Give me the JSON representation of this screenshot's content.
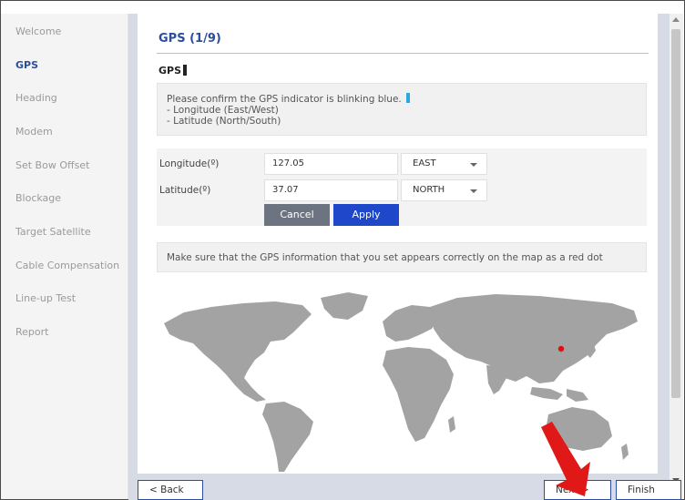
{
  "sidebar": {
    "items": [
      {
        "label": "Welcome",
        "active": false
      },
      {
        "label": "GPS",
        "active": true
      },
      {
        "label": "Heading",
        "active": false
      },
      {
        "label": "Modem",
        "active": false
      },
      {
        "label": "Set Bow Offset",
        "active": false
      },
      {
        "label": "Blockage",
        "active": false
      },
      {
        "label": "Target Satellite",
        "active": false
      },
      {
        "label": "Cable Compensation",
        "active": false
      },
      {
        "label": "Line-up Test",
        "active": false
      },
      {
        "label": "Report",
        "active": false
      }
    ]
  },
  "page": {
    "title": "GPS (1/9)",
    "section_label": "GPS"
  },
  "info": {
    "line1": "Please confirm the GPS indicator is blinking blue.",
    "line2": "- Longitude (East/West)",
    "line3": "- Latitude (North/South)"
  },
  "form": {
    "longitude_label": "Longitude(º)",
    "longitude_value": "127.05",
    "longitude_dir": "EAST",
    "latitude_label": "Latitude(º)",
    "latitude_value": "37.07",
    "latitude_dir": "NORTH",
    "cancel_label": "Cancel",
    "apply_label": "Apply"
  },
  "notice": {
    "text": "Make sure that the GPS information that you set appears correctly on the map as a red dot"
  },
  "map": {
    "marker_color": "#e01010",
    "land_color": "#a3a3a3"
  },
  "footer": {
    "back_label": "< Back",
    "next_label": "Next >",
    "finish_label": "Finish"
  },
  "colors": {
    "accent": "#2a4ea0",
    "apply": "#1f47c9",
    "cancel": "#6d7481",
    "highlight_arrow": "#e01818"
  }
}
